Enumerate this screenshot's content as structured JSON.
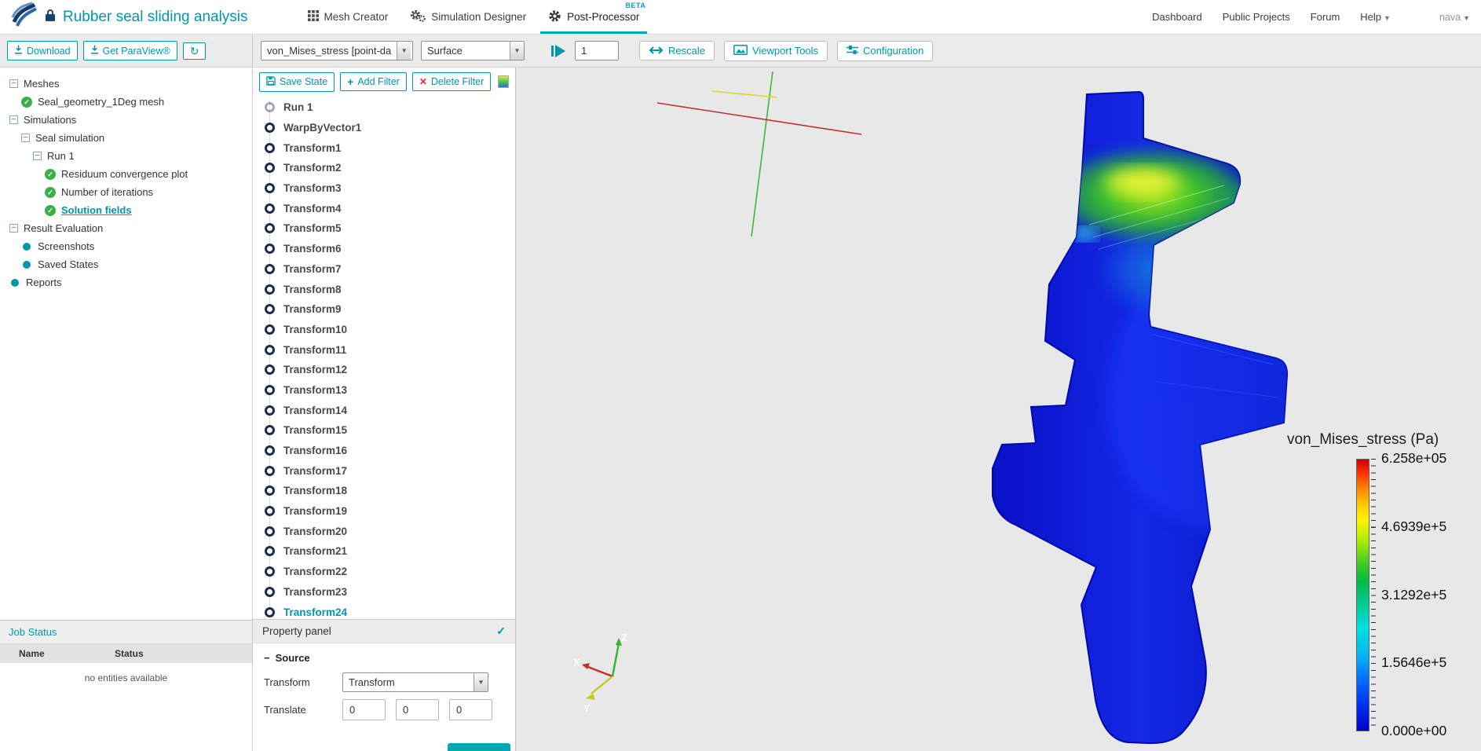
{
  "header": {
    "title": "Rubber seal sliding analysis",
    "nav": [
      {
        "label": "Mesh Creator"
      },
      {
        "label": "Simulation Designer"
      },
      {
        "label": "Post-Processor",
        "badge": "BETA"
      }
    ],
    "links": [
      {
        "label": "Dashboard"
      },
      {
        "label": "Public Projects"
      },
      {
        "label": "Forum"
      },
      {
        "label": "Help"
      }
    ],
    "user": "nava"
  },
  "sidebar": {
    "download_label": "Download",
    "paraview_label": "Get ParaView®",
    "tree": [
      {
        "label": "Meshes",
        "level": 0,
        "icon": "collapse"
      },
      {
        "label": "Seal_geometry_1Deg mesh",
        "level": 1,
        "icon": "check"
      },
      {
        "label": "Simulations",
        "level": 0,
        "icon": "collapse"
      },
      {
        "label": "Seal simulation",
        "level": 1,
        "icon": "collapse"
      },
      {
        "label": "Run 1",
        "level": 2,
        "icon": "collapse"
      },
      {
        "label": "Residuum convergence plot",
        "level": 3,
        "icon": "check"
      },
      {
        "label": "Number of iterations",
        "level": 3,
        "icon": "check"
      },
      {
        "label": "Solution fields",
        "level": 3,
        "icon": "check",
        "selected": true
      },
      {
        "label": "Result Evaluation",
        "level": 0,
        "icon": "collapse"
      },
      {
        "label": "Screenshots",
        "level": 1,
        "icon": "dot"
      },
      {
        "label": "Saved States",
        "level": 1,
        "icon": "dot"
      },
      {
        "label": "Reports",
        "level": 0,
        "icon": "dot"
      }
    ],
    "job_status": {
      "title": "Job Status",
      "name_column": "Name",
      "status_column": "Status",
      "empty_message": "no entities available"
    }
  },
  "toolbar": {
    "field_select": "von_Mises_stress [point-da",
    "representation_select": "Surface",
    "frame_value": "1",
    "rescale_label": "Rescale",
    "viewport_tools_label": "Viewport Tools",
    "configuration_label": "Configuration"
  },
  "pipeline": {
    "save_state_label": "Save State",
    "add_filter_label": "Add Filter",
    "delete_filter_label": "Delete Filter",
    "items": [
      {
        "label": "Run 1",
        "muted": true
      },
      {
        "label": "WarpByVector1"
      },
      {
        "label": "Transform1"
      },
      {
        "label": "Transform2"
      },
      {
        "label": "Transform3"
      },
      {
        "label": "Transform4"
      },
      {
        "label": "Transform5"
      },
      {
        "label": "Transform6"
      },
      {
        "label": "Transform7"
      },
      {
        "label": "Transform8"
      },
      {
        "label": "Transform9"
      },
      {
        "label": "Transform10"
      },
      {
        "label": "Transform11"
      },
      {
        "label": "Transform12"
      },
      {
        "label": "Transform13"
      },
      {
        "label": "Transform14"
      },
      {
        "label": "Transform15"
      },
      {
        "label": "Transform16"
      },
      {
        "label": "Transform17"
      },
      {
        "label": "Transform18"
      },
      {
        "label": "Transform19"
      },
      {
        "label": "Transform20"
      },
      {
        "label": "Transform21"
      },
      {
        "label": "Transform22"
      },
      {
        "label": "Transform23"
      },
      {
        "label": "Transform24",
        "selected": true
      }
    ],
    "property_panel": {
      "title": "Property panel",
      "source_section": "Source",
      "transform_label": "Transform",
      "transform_value": "Transform",
      "translate_label": "Translate",
      "translate_values": [
        "0",
        "0",
        "0"
      ]
    }
  },
  "viewport": {
    "legend": {
      "title": "von_Mises_stress (Pa)",
      "ticks": [
        "6.258e+05",
        "4.6939e+5",
        "3.1292e+5",
        "1.5646e+5",
        "0.000e+00"
      ]
    },
    "triad": {
      "x": "X",
      "y": "Y",
      "z": "Z"
    }
  }
}
